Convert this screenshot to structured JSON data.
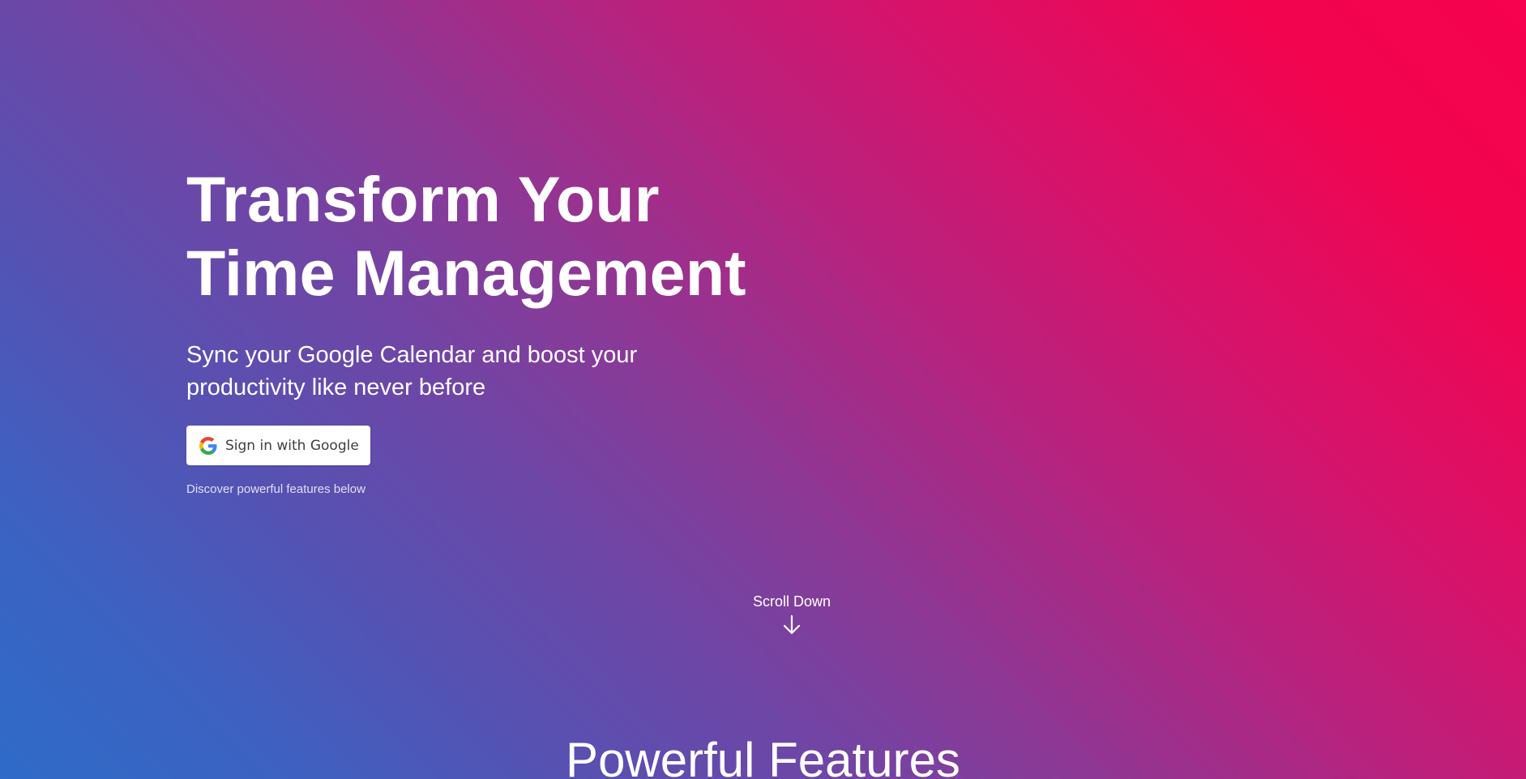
{
  "hero": {
    "title_line1": "Transform Your",
    "title_line2": "Time Management",
    "subtitle": "Sync your Google Calendar and boost your productivity like never before"
  },
  "signin": {
    "label": "Sign in with Google",
    "icon": "google-g-icon"
  },
  "discover_text": "Discover powerful features below",
  "scroll": {
    "label": "Scroll Down",
    "icon": "arrow-down-icon"
  },
  "features": {
    "heading": "Powerful Features"
  },
  "colors": {
    "gradient_start": "#f6024f",
    "gradient_mid": "#8d3895",
    "gradient_end": "#2f6bc8",
    "button_bg": "#ffffff",
    "button_text": "#3c4043"
  }
}
